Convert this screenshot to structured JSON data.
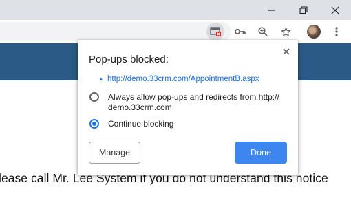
{
  "window_controls": {
    "icons": [
      "minimize-icon",
      "restore-icon",
      "close-icon"
    ]
  },
  "toolbar": {
    "icons": [
      "popup-blocked-icon",
      "key-icon",
      "zoom-icon",
      "star-icon",
      "avatar",
      "more-menu-icon"
    ]
  },
  "page": {
    "banner_color": "#2a5a85",
    "notice_text": "lease call Mr. Lee System if you do not understand this notice"
  },
  "popup": {
    "title": "Pop-ups blocked:",
    "blocked_url": "http://demo.33crm.com/AppointmentB.aspx",
    "options": [
      {
        "label": "Always allow pop-ups and redirects from http://\ndemo.33crm.com",
        "selected": false
      },
      {
        "label": "Continue blocking",
        "selected": true
      }
    ],
    "manage_label": "Manage",
    "done_label": "Done",
    "accent_color": "#1a73e8"
  }
}
